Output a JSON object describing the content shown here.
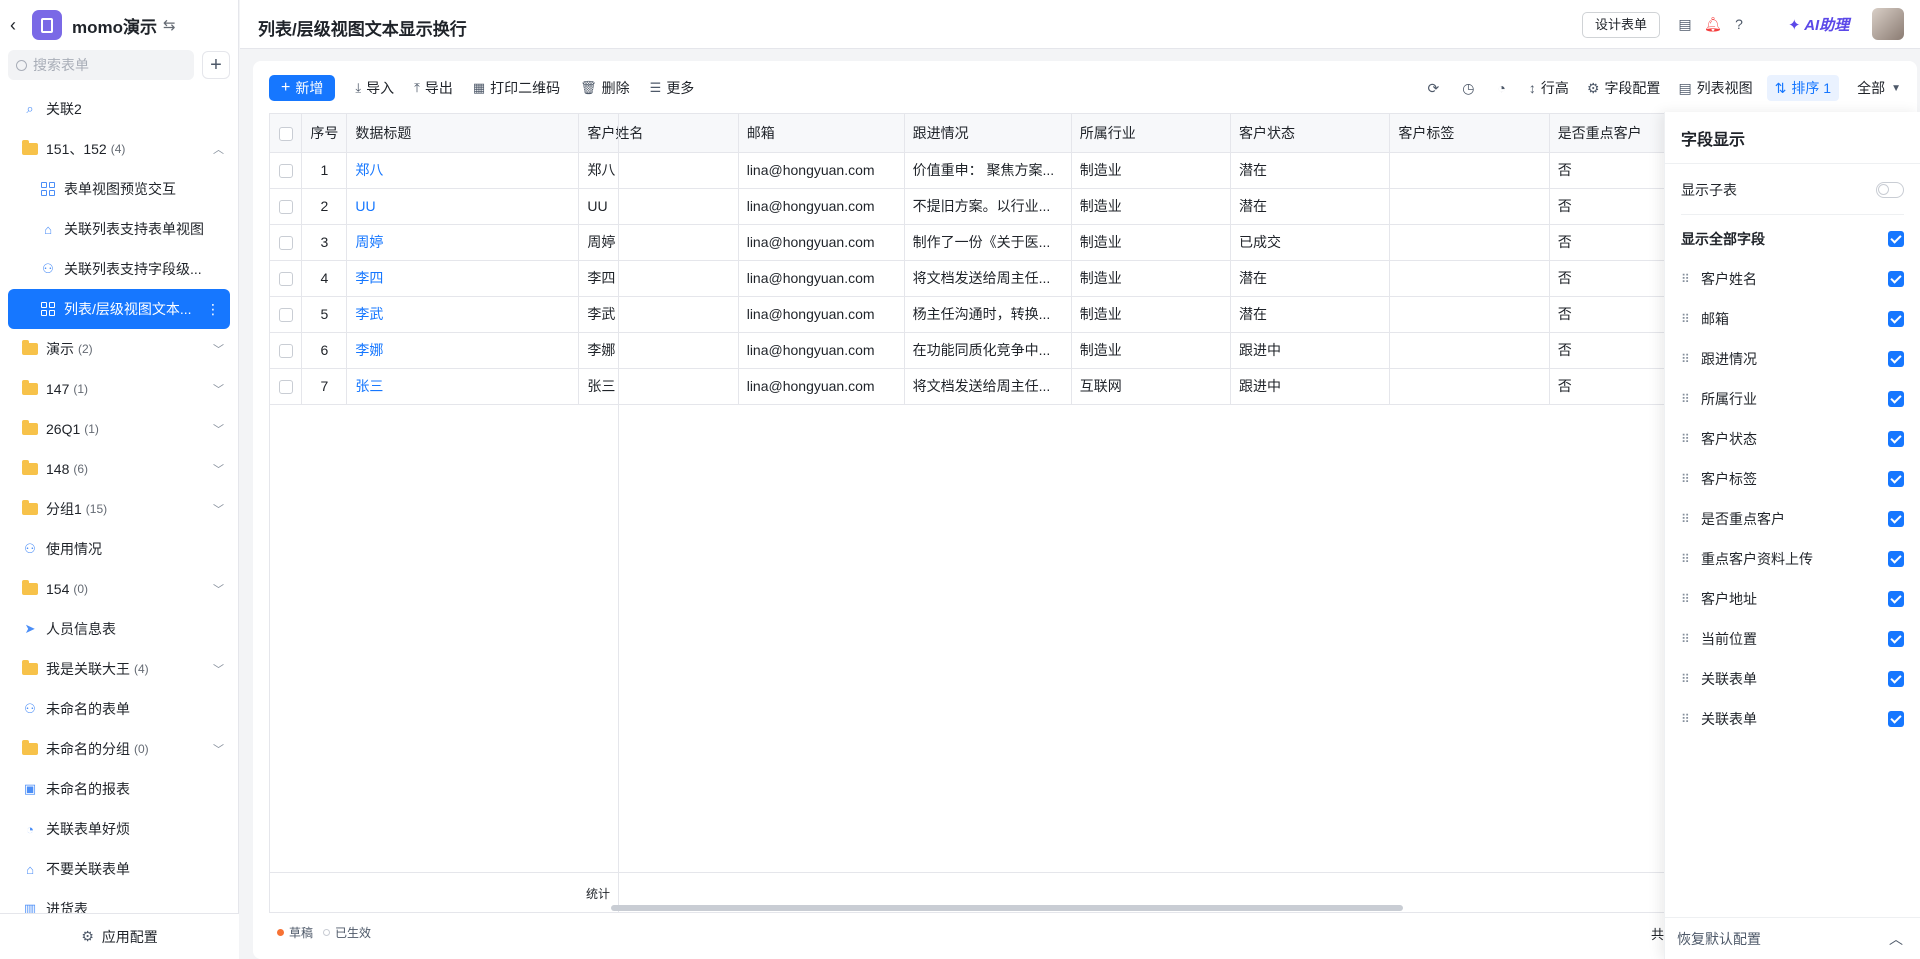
{
  "app": {
    "name": "momo演示",
    "search_placeholder": "搜索表单",
    "footer_label": "应用配置"
  },
  "nav": [
    {
      "label": "关联2",
      "count": "",
      "icon": "report-search-icon",
      "child": false,
      "folder": false
    },
    {
      "label": "151、152",
      "count": "(4)",
      "icon": "folder-icon",
      "child": false,
      "folder": true,
      "expanded": true
    },
    {
      "label": "表单视图预览交互",
      "count": "",
      "icon": "grid-form-icon",
      "child": true,
      "folder": false
    },
    {
      "label": "关联列表支持表单视图",
      "count": "",
      "icon": "home-form-icon",
      "child": true,
      "folder": false
    },
    {
      "label": "关联列表支持字段级...",
      "count": "",
      "icon": "user-form-icon",
      "child": true,
      "folder": false
    },
    {
      "label": "列表/层级视图文本...",
      "count": "",
      "icon": "grid-form-icon",
      "child": true,
      "folder": false,
      "active": true
    },
    {
      "label": "演示",
      "count": "(2)",
      "icon": "folder-icon",
      "child": false,
      "folder": true
    },
    {
      "label": "147",
      "count": "(1)",
      "icon": "folder-icon",
      "child": false,
      "folder": true
    },
    {
      "label": "26Q1",
      "count": "(1)",
      "icon": "folder-icon",
      "child": false,
      "folder": true
    },
    {
      "label": "148",
      "count": "(6)",
      "icon": "folder-icon",
      "child": false,
      "folder": true
    },
    {
      "label": "分组1",
      "count": "(15)",
      "icon": "folder-icon",
      "child": false,
      "folder": true
    },
    {
      "label": "使用情况",
      "count": "",
      "icon": "user-icon",
      "child": false,
      "folder": false
    },
    {
      "label": "154",
      "count": "(0)",
      "icon": "folder-icon",
      "child": false,
      "folder": true
    },
    {
      "label": "人员信息表",
      "count": "",
      "icon": "cursor-icon",
      "child": false,
      "folder": false
    },
    {
      "label": "我是关联大王",
      "count": "(4)",
      "icon": "folder-icon",
      "child": false,
      "folder": true
    },
    {
      "label": "未命名的表单",
      "count": "",
      "icon": "user-add-icon",
      "child": false,
      "folder": false
    },
    {
      "label": "未命名的分组",
      "count": "(0)",
      "icon": "folder-icon",
      "child": false,
      "folder": true
    },
    {
      "label": "未命名的报表",
      "count": "",
      "icon": "report-icon",
      "child": false,
      "folder": false
    },
    {
      "label": "关联表单好烦",
      "count": "",
      "icon": "pie-icon",
      "child": false,
      "folder": false
    },
    {
      "label": "不要关联表单",
      "count": "",
      "icon": "home-form-icon",
      "child": false,
      "folder": false
    },
    {
      "label": "进货表",
      "count": "",
      "icon": "kanban-icon",
      "child": false,
      "folder": false
    }
  ],
  "topbar": {
    "title": "列表/层级视图文本显示换行",
    "design_button": "设计表单",
    "ai_label": "AI助理"
  },
  "toolbar": {
    "add": "新增",
    "import": "导入",
    "export": "导出",
    "print_qr": "打印二维码",
    "delete": "删除",
    "more": "更多",
    "row_height": "行高",
    "field_config": "字段配置",
    "list_view": "列表视图",
    "sort": "排序 1",
    "filter_all": "全部"
  },
  "table": {
    "columns": [
      "序号",
      "数据标题",
      "客户姓名",
      "邮箱",
      "跟进情况",
      "所属行业",
      "客户状态",
      "客户标签",
      "是否重点客户"
    ],
    "rows": [
      [
        "1",
        "郑八",
        "郑八",
        "lina@hongyuan.com",
        "价值重申： 聚焦方案...",
        "制造业",
        "潜在",
        "",
        "否"
      ],
      [
        "2",
        "UU",
        "UU",
        "lina@hongyuan.com",
        "不提旧方案。以行业...",
        "制造业",
        "潜在",
        "",
        "否"
      ],
      [
        "3",
        "周婷",
        "周婷",
        "lina@hongyuan.com",
        "制作了一份《关于医...",
        "制造业",
        "已成交",
        "",
        "否"
      ],
      [
        "4",
        "李四",
        "李四",
        "lina@hongyuan.com",
        "将文档发送给周主任...",
        "制造业",
        "潜在",
        "",
        "否"
      ],
      [
        "5",
        "李武",
        "李武",
        "lina@hongyuan.com",
        "杨主任沟通时，转换...",
        "制造业",
        "潜在",
        "",
        "否"
      ],
      [
        "6",
        "李娜",
        "李娜",
        "lina@hongyuan.com",
        "在功能同质化竞争中...",
        "制造业",
        "跟进中",
        "",
        "否"
      ],
      [
        "7",
        "张三",
        "张三",
        "lina@hongyuan.com",
        "将文档发送给周主任...",
        "互联网",
        "跟进中",
        "",
        "否"
      ]
    ],
    "stat_label": "统计"
  },
  "footer": {
    "draft": "草稿",
    "active": "已生效",
    "total_prefix": "共"
  },
  "field_panel": {
    "title": "字段显示",
    "show_subtable": "显示子表",
    "show_all": "显示全部字段",
    "fields": [
      "客户姓名",
      "邮箱",
      "跟进情况",
      "所属行业",
      "客户状态",
      "客户标签",
      "是否重点客户",
      "重点客户资料上传",
      "客户地址",
      "当前位置",
      "关联表单",
      "关联表单"
    ],
    "reset": "恢复默认配置"
  },
  "colors": {
    "accent": "#1677ff",
    "draft_dot": "#f77234",
    "ai": "#5b48e8"
  }
}
